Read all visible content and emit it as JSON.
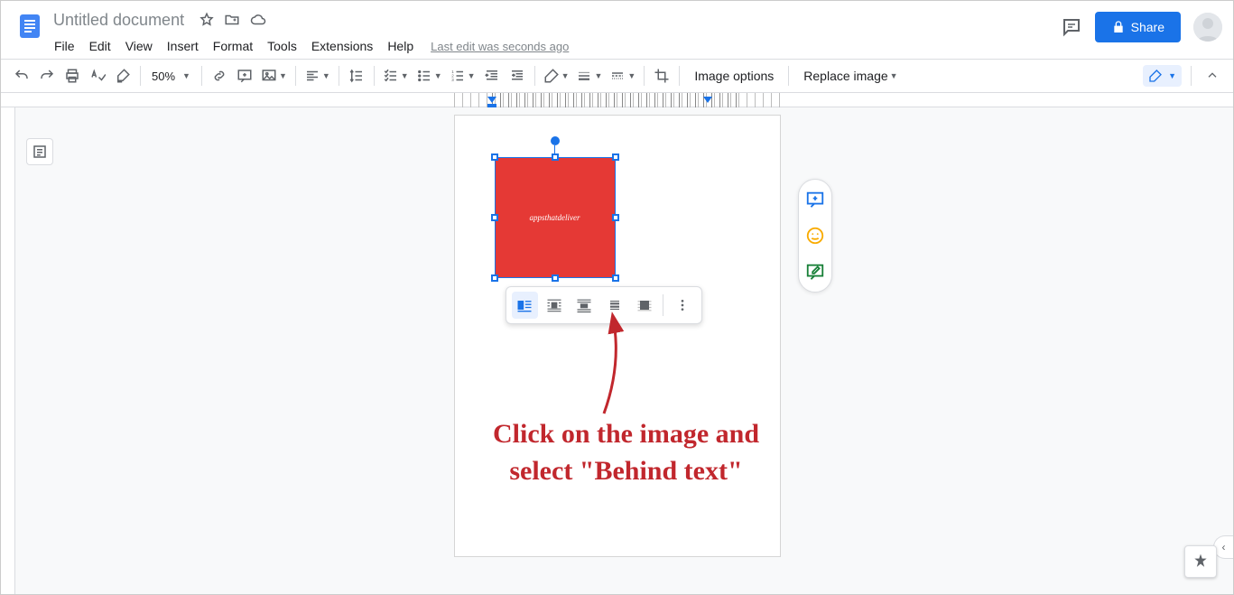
{
  "app": {
    "title": "Untitled document",
    "last_edit": "Last edit was seconds ago",
    "share_label": "Share"
  },
  "menus": [
    "File",
    "Edit",
    "View",
    "Insert",
    "Format",
    "Tools",
    "Extensions",
    "Help"
  ],
  "toolbar": {
    "zoom": "50%",
    "image_options": "Image options",
    "replace_image": "Replace image"
  },
  "image_in_page": {
    "text": "appsthatdeliver"
  },
  "annotation": {
    "line1": "Click on the image and",
    "line2": "select \"Behind text\""
  }
}
